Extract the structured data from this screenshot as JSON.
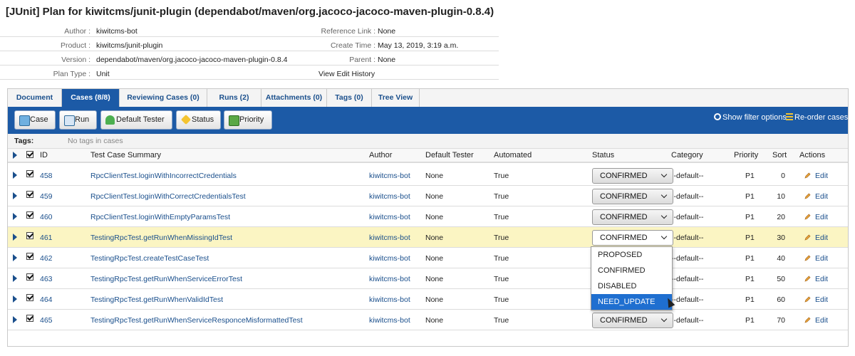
{
  "title": "[JUnit] Plan for kiwitcms/junit-plugin (dependabot/maven/org.jacoco-jacoco-maven-plugin-0.8.4)",
  "meta": {
    "author_label": "Author :",
    "author": "kiwitcms-bot",
    "product_label": "Product :",
    "product": "kiwitcms/junit-plugin",
    "version_label": "Version :",
    "version": "dependabot/maven/org.jacoco-jacoco-maven-plugin-0.8.4",
    "plan_type_label": "Plan Type :",
    "plan_type": "Unit",
    "reference_label": "Reference Link :",
    "reference": "None",
    "create_label": "Create Time :",
    "create_time": "May 13, 2019, 3:19 a.m.",
    "parent_label": "Parent :",
    "parent": "None",
    "history_link": "View Edit History"
  },
  "tabs": [
    {
      "label": "Document",
      "active": false
    },
    {
      "label": "Cases (8/8)",
      "active": true
    },
    {
      "label": "Reviewing Cases (0)",
      "active": false
    },
    {
      "label": "Runs (2)",
      "active": false
    },
    {
      "label": "Attachments (0)",
      "active": false
    },
    {
      "label": "Tags (0)",
      "active": false
    },
    {
      "label": "Tree View",
      "active": false
    }
  ],
  "toolbar": {
    "case": "Case",
    "run": "Run",
    "default_tester": "Default Tester",
    "status": "Status",
    "priority": "Priority",
    "filter": "Show filter options",
    "reorder": "Re-order cases"
  },
  "tags": {
    "label": "Tags:",
    "value": "No tags in cases"
  },
  "columns": {
    "id": "ID",
    "summary": "Test Case Summary",
    "author": "Author",
    "tester": "Default Tester",
    "automated": "Automated",
    "status": "Status",
    "category": "Category",
    "priority": "Priority",
    "sort": "Sort",
    "actions": "Actions"
  },
  "rows": [
    {
      "id": "458",
      "summary": "RpcClientTest.loginWithIncorrectCredentials",
      "author": "kiwitcms-bot",
      "tester": "None",
      "automated": "True",
      "status": "CONFIRMED",
      "category": "--default--",
      "priority": "P1",
      "sort": "0",
      "action": "Edit"
    },
    {
      "id": "459",
      "summary": "RpcClientTest.loginWithCorrectCredentialsTest",
      "author": "kiwitcms-bot",
      "tester": "None",
      "automated": "True",
      "status": "CONFIRMED",
      "category": "--default--",
      "priority": "P1",
      "sort": "10",
      "action": "Edit"
    },
    {
      "id": "460",
      "summary": "RpcClientTest.loginWithEmptyParamsTest",
      "author": "kiwitcms-bot",
      "tester": "None",
      "automated": "True",
      "status": "CONFIRMED",
      "category": "--default--",
      "priority": "P1",
      "sort": "20",
      "action": "Edit"
    },
    {
      "id": "461",
      "summary": "TestingRpcTest.getRunWhenMissingIdTest",
      "author": "kiwitcms-bot",
      "tester": "None",
      "automated": "True",
      "status": "CONFIRMED",
      "category": "--default--",
      "priority": "P1",
      "sort": "30",
      "action": "Edit"
    },
    {
      "id": "462",
      "summary": "TestingRpcTest.createTestCaseTest",
      "author": "kiwitcms-bot",
      "tester": "None",
      "automated": "True",
      "status": "",
      "category": "--default--",
      "priority": "P1",
      "sort": "40",
      "action": "Edit"
    },
    {
      "id": "463",
      "summary": "TestingRpcTest.getRunWhenServiceErrorTest",
      "author": "kiwitcms-bot",
      "tester": "None",
      "automated": "True",
      "status": "",
      "category": "--default--",
      "priority": "P1",
      "sort": "50",
      "action": "Edit"
    },
    {
      "id": "464",
      "summary": "TestingRpcTest.getRunWhenValidIdTest",
      "author": "kiwitcms-bot",
      "tester": "None",
      "automated": "True",
      "status": "",
      "category": "--default--",
      "priority": "P1",
      "sort": "60",
      "action": "Edit"
    },
    {
      "id": "465",
      "summary": "TestingRpcTest.getRunWhenServiceResponceMisformattedTest",
      "author": "kiwitcms-bot",
      "tester": "None",
      "automated": "True",
      "status": "CONFIRMED",
      "category": "--default--",
      "priority": "P1",
      "sort": "70",
      "action": "Edit"
    }
  ],
  "status_options": [
    "PROPOSED",
    "CONFIRMED",
    "DISABLED",
    "NEED_UPDATE"
  ],
  "colors": {
    "accent": "#1c5aa6",
    "link": "#1a4f8c",
    "highlight_row": "#fbf5c3",
    "selected_option": "#1f6fd0"
  }
}
